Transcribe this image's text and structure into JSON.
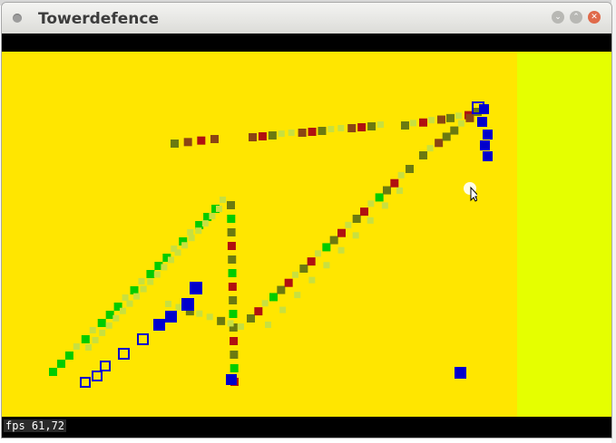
{
  "window": {
    "title": "Towerdefence",
    "buttons": [
      "minimize",
      "maximize",
      "close"
    ]
  },
  "status": {
    "fps_label": "fps 61,72"
  },
  "colors": {
    "playfield": "#ffe600",
    "side_panel": "#e5ff00",
    "bars": "#000000",
    "tower": "#0000cc",
    "creep_green": "#00cc00",
    "creep_olive": "#6b7a10",
    "creep_brown": "#8b4513",
    "creep_red": "#b01010",
    "projectile": "#c8e040"
  },
  "icons": [
    "window-dot-icon",
    "minimize-icon",
    "maximize-icon",
    "close-icon",
    "mouse-cursor-icon"
  ]
}
